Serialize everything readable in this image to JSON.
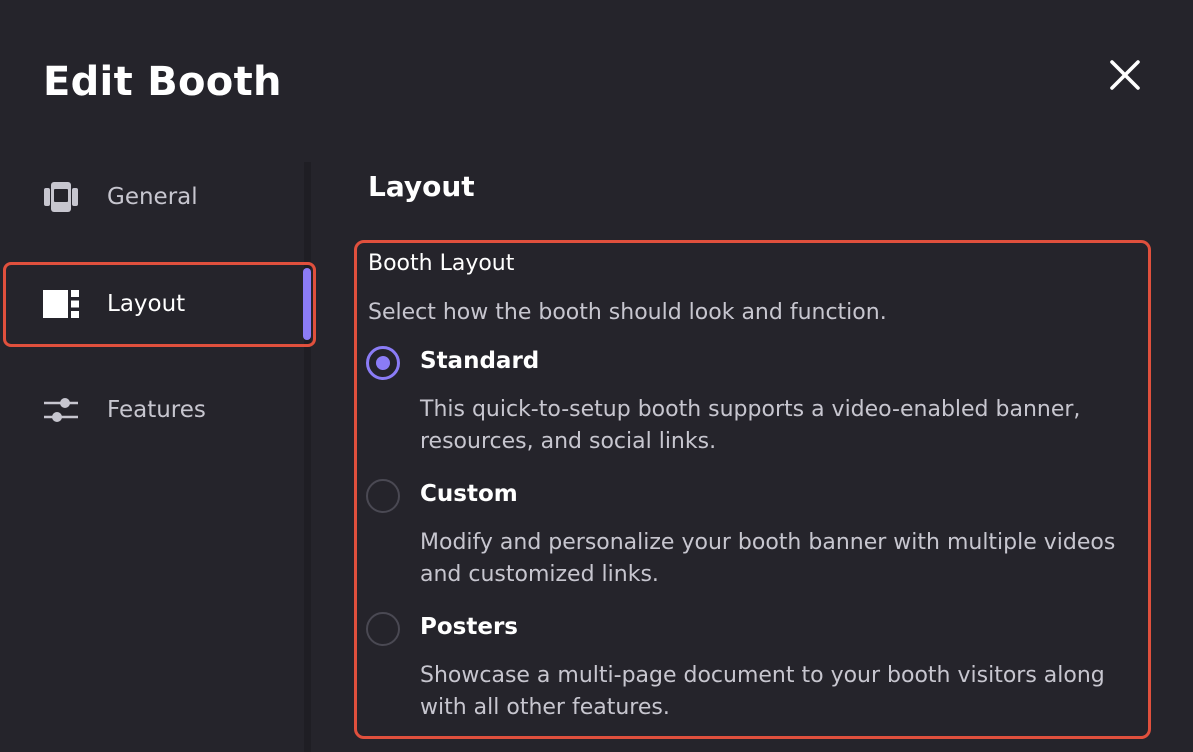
{
  "dialog": {
    "title": "Edit Booth",
    "close_icon": "close-icon"
  },
  "sidebar": {
    "items": [
      {
        "label": "General",
        "icon": "booth-icon",
        "active": false
      },
      {
        "label": "Layout",
        "icon": "layout-icon",
        "active": true
      },
      {
        "label": "Features",
        "icon": "sliders-icon",
        "active": false
      }
    ]
  },
  "content": {
    "section_title": "Layout",
    "group": {
      "label": "Booth Layout",
      "description": "Select how the booth should look and function.",
      "options": [
        {
          "title": "Standard",
          "description": "This quick-to-setup booth supports a video-enabled banner, resources, and social links.",
          "selected": true
        },
        {
          "title": "Custom",
          "description": "Modify and personalize your booth banner with multiple videos and customized links.",
          "selected": false
        },
        {
          "title": "Posters",
          "description": "Showcase a multi-page document to your booth visitors along with all other features.",
          "selected": false
        }
      ]
    }
  },
  "colors": {
    "background": "#25242b",
    "accent": "#8b7cf6",
    "highlight_border": "#e0503d",
    "muted_text": "#c7c6cf"
  }
}
